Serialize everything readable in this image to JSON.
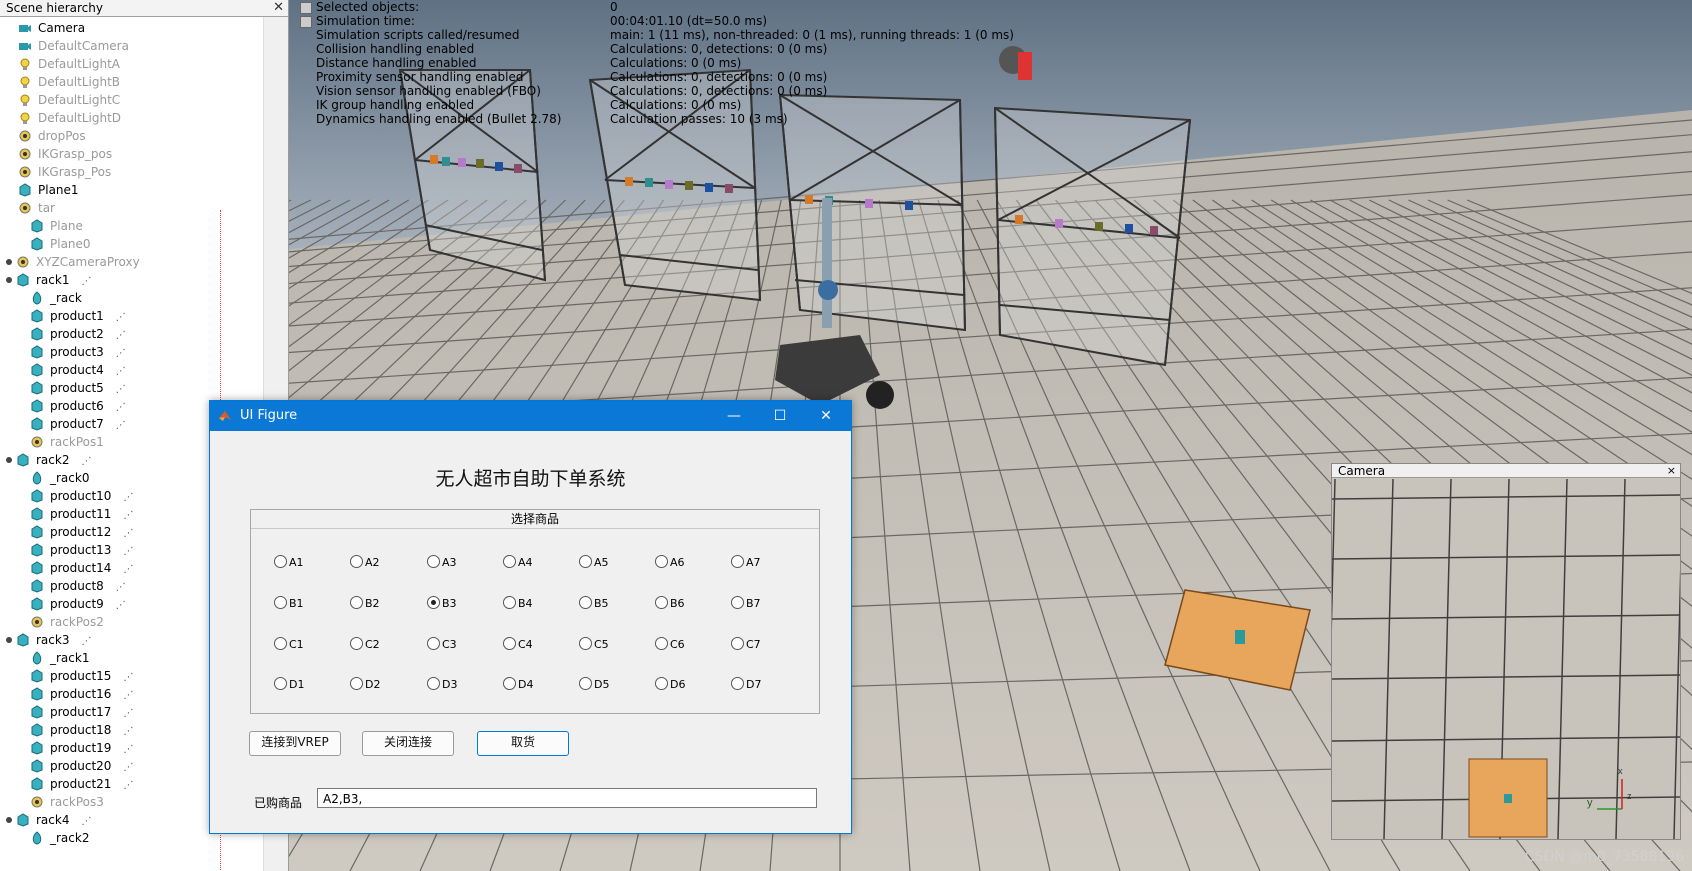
{
  "hierarchy": {
    "title": "Scene hierarchy",
    "items": [
      {
        "label": "Camera",
        "icon": "camera-icon",
        "dim": false
      },
      {
        "label": "DefaultCamera",
        "icon": "camera-icon",
        "dim": true
      },
      {
        "label": "DefaultLightA",
        "icon": "light-icon",
        "dim": true
      },
      {
        "label": "DefaultLightB",
        "icon": "light-icon",
        "dim": true
      },
      {
        "label": "DefaultLightC",
        "icon": "light-icon",
        "dim": true
      },
      {
        "label": "DefaultLightD",
        "icon": "light-icon",
        "dim": true
      },
      {
        "label": "dropPos",
        "icon": "dummy-icon",
        "dim": true
      },
      {
        "label": "IKGrasp_pos",
        "icon": "dummy-icon",
        "dim": true
      },
      {
        "label": "IKGrasp_Pos",
        "icon": "dummy-icon",
        "dim": true
      },
      {
        "label": "Plane1",
        "icon": "shape-icon",
        "dim": false
      },
      {
        "label": "tar",
        "icon": "dummy-icon",
        "dim": true
      },
      {
        "label": "Plane",
        "icon": "shape-icon",
        "dim": true
      },
      {
        "label": "Plane0",
        "icon": "shape-icon",
        "dim": true
      },
      {
        "label": "XYZCameraProxy",
        "icon": "dummy-icon",
        "dim": true
      },
      {
        "label": "rack1",
        "icon": "shape-icon",
        "dim": false
      },
      {
        "label": "_rack",
        "icon": "convex-shape-icon",
        "dim": false
      },
      {
        "label": "product1",
        "icon": "shape-icon",
        "dim": false
      },
      {
        "label": "product2",
        "icon": "shape-icon",
        "dim": false
      },
      {
        "label": "product3",
        "icon": "shape-icon",
        "dim": false
      },
      {
        "label": "product4",
        "icon": "shape-icon",
        "dim": false
      },
      {
        "label": "product5",
        "icon": "shape-icon",
        "dim": false
      },
      {
        "label": "product6",
        "icon": "shape-icon",
        "dim": false
      },
      {
        "label": "product7",
        "icon": "shape-icon",
        "dim": false
      },
      {
        "label": "rackPos1",
        "icon": "dummy-icon",
        "dim": true
      },
      {
        "label": "rack2",
        "icon": "shape-icon",
        "dim": false
      },
      {
        "label": "_rack0",
        "icon": "convex-shape-icon",
        "dim": false
      },
      {
        "label": "product10",
        "icon": "shape-icon",
        "dim": false
      },
      {
        "label": "product11",
        "icon": "shape-icon",
        "dim": false
      },
      {
        "label": "product12",
        "icon": "shape-icon",
        "dim": false
      },
      {
        "label": "product13",
        "icon": "shape-icon",
        "dim": false
      },
      {
        "label": "product14",
        "icon": "shape-icon",
        "dim": false
      },
      {
        "label": "product8",
        "icon": "shape-icon",
        "dim": false
      },
      {
        "label": "product9",
        "icon": "shape-icon",
        "dim": false
      },
      {
        "label": "rackPos2",
        "icon": "dummy-icon",
        "dim": true
      },
      {
        "label": "rack3",
        "icon": "shape-icon",
        "dim": false
      },
      {
        "label": "_rack1",
        "icon": "convex-shape-icon",
        "dim": false
      },
      {
        "label": "product15",
        "icon": "shape-icon",
        "dim": false
      },
      {
        "label": "product16",
        "icon": "shape-icon",
        "dim": false
      },
      {
        "label": "product17",
        "icon": "shape-icon",
        "dim": false
      },
      {
        "label": "product18",
        "icon": "shape-icon",
        "dim": false
      },
      {
        "label": "product19",
        "icon": "shape-icon",
        "dim": false
      },
      {
        "label": "product20",
        "icon": "shape-icon",
        "dim": false
      },
      {
        "label": "product21",
        "icon": "shape-icon",
        "dim": false
      },
      {
        "label": "rackPos3",
        "icon": "dummy-icon",
        "dim": true
      },
      {
        "label": "rack4",
        "icon": "shape-icon",
        "dim": false
      },
      {
        "label": "_rack2",
        "icon": "convex-shape-icon",
        "dim": false
      }
    ]
  },
  "info": [
    {
      "key": "Selected objects:",
      "value": "0"
    },
    {
      "key": "Simulation time:",
      "value": "00:04:01.10 (dt=50.0 ms)"
    },
    {
      "key": "Simulation scripts called/resumed",
      "value": "main: 1 (11 ms), non-threaded: 0 (1 ms), running threads: 1 (0 ms)"
    },
    {
      "key": "Collision handling enabled",
      "value": "Calculations: 0, detections: 0 (0 ms)"
    },
    {
      "key": "Distance handling enabled",
      "value": "Calculations: 0 (0 ms)"
    },
    {
      "key": "Proximity sensor handling enabled",
      "value": "Calculations: 0, detections: 0 (0 ms)"
    },
    {
      "key": "Vision sensor handling enabled (FBO)",
      "value": "Calculations: 0, detections: 0 (0 ms)"
    },
    {
      "key": "IK group handling enabled",
      "value": "Calculations: 0 (0 ms)"
    },
    {
      "key": "Dynamics handling enabled (Bullet 2.78)",
      "value": "Calculation passes: 10 (3 ms)"
    }
  ],
  "dialog": {
    "title": "UI Figure",
    "minimize": "—",
    "maximize": "☐",
    "close": "✕",
    "heading": "无人超市自助下单系统",
    "panel_title": "选择商品",
    "selected": "B3",
    "options": [
      [
        "A1",
        "A2",
        "A3",
        "A4",
        "A5",
        "A6",
        "A7"
      ],
      [
        "B1",
        "B2",
        "B3",
        "B4",
        "B5",
        "B6",
        "B7"
      ],
      [
        "C1",
        "C2",
        "C3",
        "C4",
        "C5",
        "C6",
        "C7"
      ],
      [
        "D1",
        "D2",
        "D3",
        "D4",
        "D5",
        "D6",
        "D7"
      ]
    ],
    "connect_label": "连接到VREP",
    "disconnect_label": "关闭连接",
    "pickup_label": "取货",
    "bought_label": "已购商品",
    "bought_value": "A2,B3,"
  },
  "camera_view": {
    "title": "Camera",
    "close": "×",
    "axis_y": "y",
    "axis_z": "z",
    "axis_x": "x"
  },
  "watermark": "CSDN @m0_73588196",
  "colors": {
    "titlebar": "#0c78d5",
    "floor": "#c4bfb5",
    "sky": "#7a8ca0",
    "pad": "#e8a65c"
  }
}
